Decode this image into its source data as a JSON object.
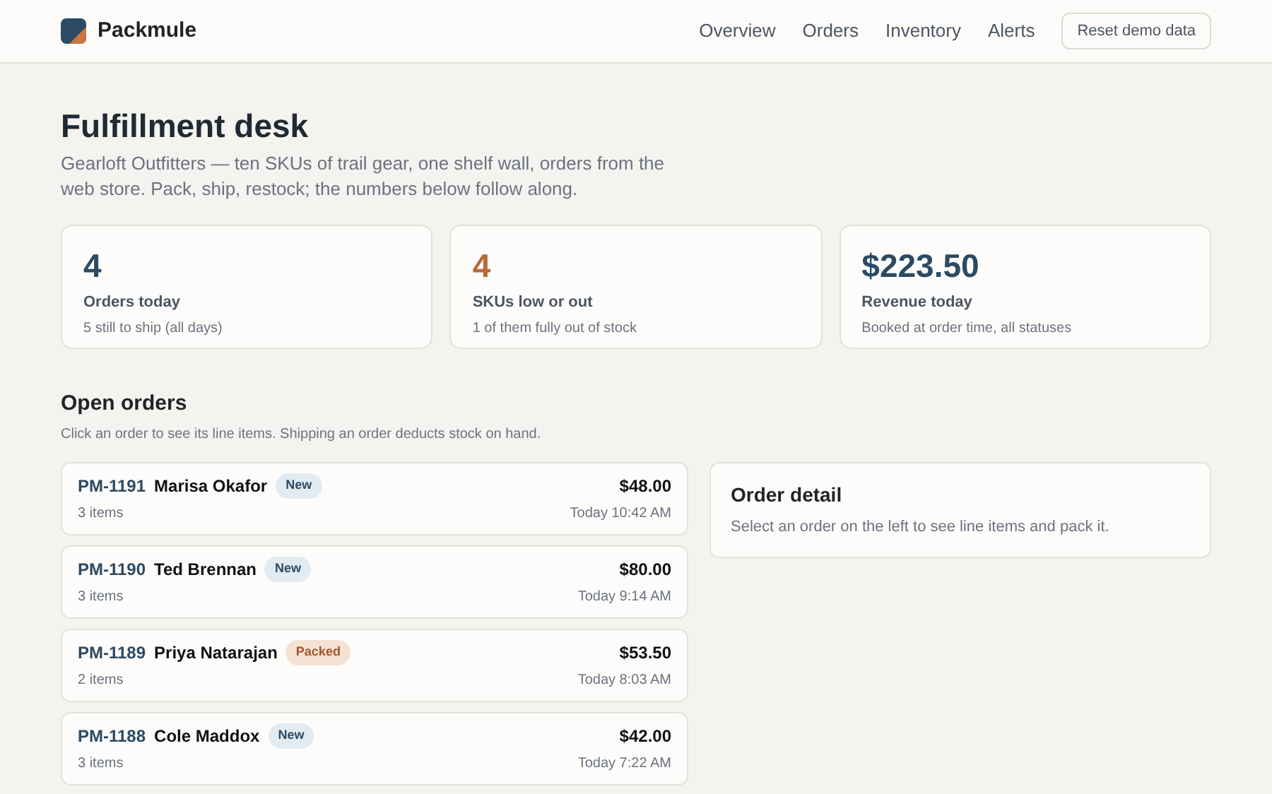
{
  "brand": {
    "name": "Packmule"
  },
  "nav": [
    {
      "label": "Overview"
    },
    {
      "label": "Orders"
    },
    {
      "label": "Inventory"
    },
    {
      "label": "Alerts"
    }
  ],
  "reset_button": "Reset demo data",
  "page": {
    "title": "Fulfillment desk",
    "description": "Gearloft Outfitters — ten SKUs of trail gear, one shelf wall, orders from the web store. Pack, ship, restock; the numbers below follow along."
  },
  "stats": [
    {
      "value": "4",
      "label": "Orders today",
      "note": "5 still to ship (all days)",
      "kind": "normal"
    },
    {
      "value": "4",
      "label": "SKUs low or out",
      "note": "1 of them fully out of stock",
      "kind": "warning"
    },
    {
      "value": "$223.50",
      "label": "Revenue today",
      "note": "Booked at order time, all statuses",
      "kind": "normal"
    }
  ],
  "open_orders": {
    "title": "Open orders",
    "hint": "Click an order to see its line items. Shipping an order deducts stock on hand.",
    "orders": [
      {
        "id": "PM-1191",
        "customer": "Marisa Okafor",
        "status": "New",
        "kind": "new",
        "items": "3 items",
        "total": "$48.00",
        "time": "Today 10:42 AM"
      },
      {
        "id": "PM-1190",
        "customer": "Ted Brennan",
        "status": "New",
        "kind": "new",
        "items": "3 items",
        "total": "$80.00",
        "time": "Today 9:14 AM"
      },
      {
        "id": "PM-1189",
        "customer": "Priya Natarajan",
        "status": "Packed",
        "kind": "packed",
        "items": "2 items",
        "total": "$53.50",
        "time": "Today 8:03 AM"
      },
      {
        "id": "PM-1188",
        "customer": "Cole Maddox",
        "status": "New",
        "kind": "new",
        "items": "3 items",
        "total": "$42.00",
        "time": "Today 7:22 AM"
      }
    ]
  },
  "order_detail": {
    "title": "Order detail",
    "hint": "Select an order on the left to see line items and pack it."
  }
}
